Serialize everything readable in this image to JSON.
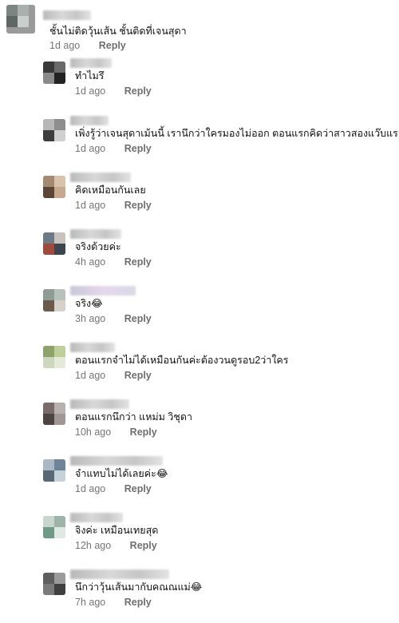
{
  "comments": [
    {
      "text": "ชั้นไม่ติดวุ้นเส้น ชั้นติดที่เจนสุดา",
      "age": "1d ago",
      "reply_label": "Reply"
    },
    {
      "text": "ทำไมรึ",
      "age": "1d ago",
      "reply_label": "Reply"
    },
    {
      "text": "เพิ่งรู้ว่าเจนสุดาเม้นนี้ เรานึกว่าใครมองไม่ออก ตอนแรกคิดว่าสาวสองแว๊บแรก",
      "age": "1d ago",
      "reply_label": "Reply"
    },
    {
      "text": "คิดเหมือนกันเลย",
      "age": "1d ago",
      "reply_label": "Reply"
    },
    {
      "text": "จริงด้วยค่ะ",
      "age": "4h ago",
      "reply_label": "Reply"
    },
    {
      "text": "จริง😂",
      "age": "3h ago",
      "reply_label": "Reply"
    },
    {
      "text": "ตอนแรกจำไม่ได้เหมือนกันค่ะต้องวนดูรอบ2ว่าใคร",
      "age": "1d ago",
      "reply_label": "Reply"
    },
    {
      "text": "ตอนแรกนึกว่า แหม่ม วิชุดา",
      "age": "10h ago",
      "reply_label": "Reply"
    },
    {
      "text": "จำแทบไม่ได้เลยค่ะ😂",
      "age": "1d ago",
      "reply_label": "Reply"
    },
    {
      "text": "จิงค่ะ เหมือนเทยสุด",
      "age": "12h ago",
      "reply_label": "Reply"
    },
    {
      "text": "นึกว่าวุ้นเส้นมากับคณณแม่😂",
      "age": "7h ago",
      "reply_label": "Reply"
    }
  ],
  "colors": {
    "text": "#111111",
    "meta": "#757575",
    "reply": "#6f6f6f",
    "background": "#ffffff"
  }
}
